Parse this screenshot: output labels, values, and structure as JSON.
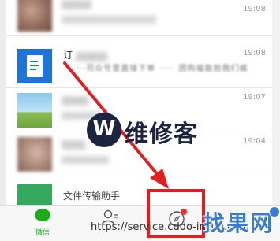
{
  "chat_list": {
    "rows": [
      {
        "time": "19:08",
        "title": "",
        "preview": ""
      },
      {
        "time": "19:08",
        "title": "订",
        "preview": "·······司众号里直接下单 ····· 团购福能拍我们威"
      },
      {
        "time": "19:07",
        "title": "",
        "preview": ""
      },
      {
        "time": "19:04",
        "title": "",
        "preview": ""
      },
      {
        "time": "",
        "title": "文件传输助手",
        "preview": ""
      }
    ]
  },
  "tabbar": {
    "chats_label": "微信",
    "contacts_label": "",
    "discover_label": ""
  },
  "watermark": {
    "brand_letter": "W",
    "brand_text": "维修客",
    "url_text": "https://service.cddo-inzun.com",
    "logo_text": "找果网"
  },
  "colors": {
    "accent_green": "#1aad19",
    "highlight_red": "#e02020",
    "doc_blue": "#1e73d6"
  }
}
